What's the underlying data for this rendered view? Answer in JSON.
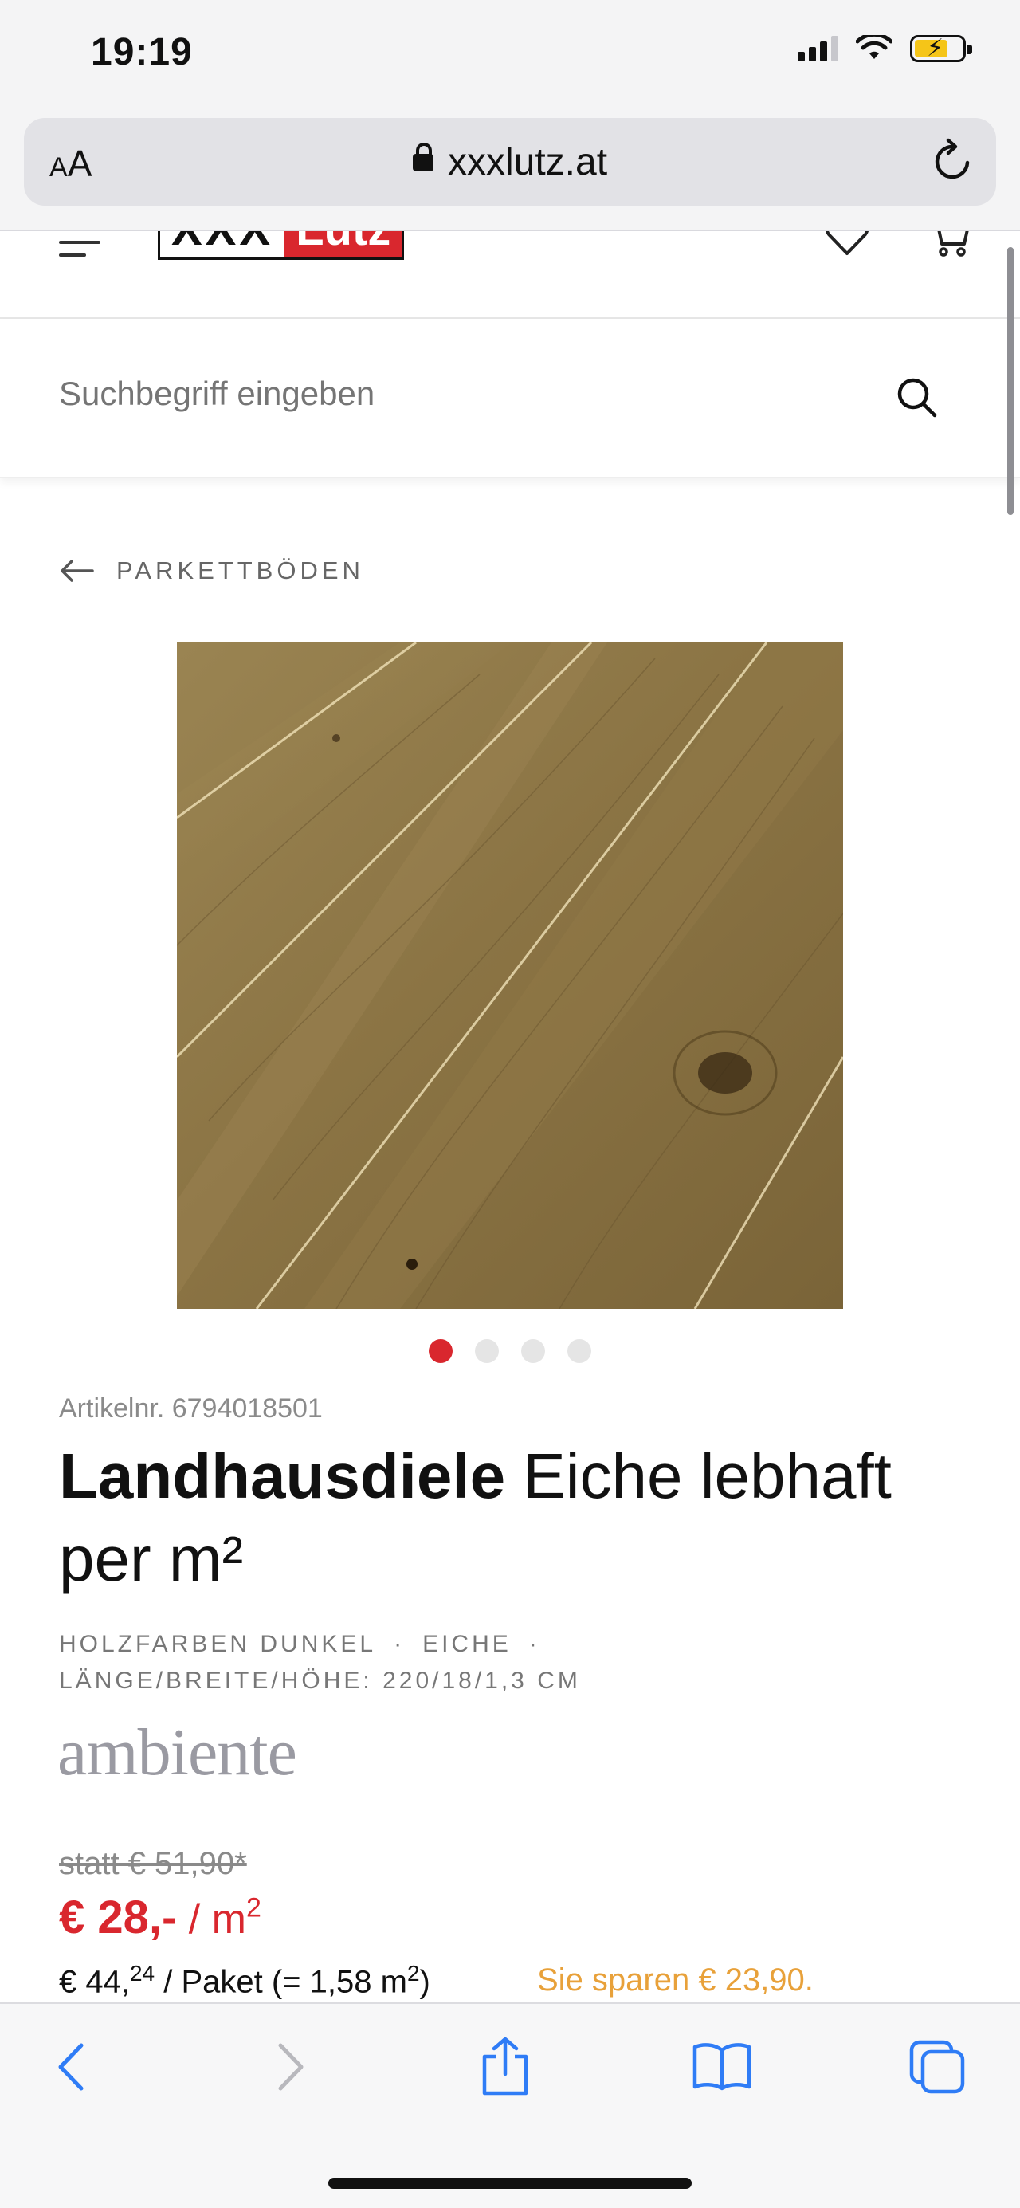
{
  "status_bar": {
    "time": "19:19"
  },
  "browser": {
    "aa_label_small": "A",
    "aa_label_large": "A",
    "url": "xxxlutz.at"
  },
  "header": {
    "logo_left": "XXX",
    "logo_right": "Lutz"
  },
  "search": {
    "placeholder": "Suchbegriff eingeben"
  },
  "breadcrumb": {
    "label": "PARKETTBÖDEN"
  },
  "carousel": {
    "total": 4,
    "active_index": 0
  },
  "product": {
    "article_label": "Artikelnr. 6794018501",
    "title_bold": "Landhausdiele",
    "title_rest": " Eiche lebhaft per m²",
    "attr_color": "HOLZFARBEN DUNKEL",
    "attr_wood": "EICHE",
    "attr_separator": "·",
    "attr_dimensions": "LÄNGE/BREITE/HÖHE: 220/18/1,3 CM",
    "brand": "ambiente"
  },
  "pricing": {
    "old_price": "statt € 51,90*",
    "price": "€ 28,-",
    "price_unit": " / m",
    "price_unit_sup": "2",
    "package_prefix": "€ 44,",
    "package_cents": "24",
    "package_suffix": " / Paket (= 1,58 m",
    "package_sup": "2",
    "package_close": ")",
    "savings": "Sie sparen € 23,90."
  },
  "colors": {
    "accent_red": "#d9272e",
    "savings_orange": "#e8a13a",
    "ios_blue": "#2f7cf6"
  }
}
